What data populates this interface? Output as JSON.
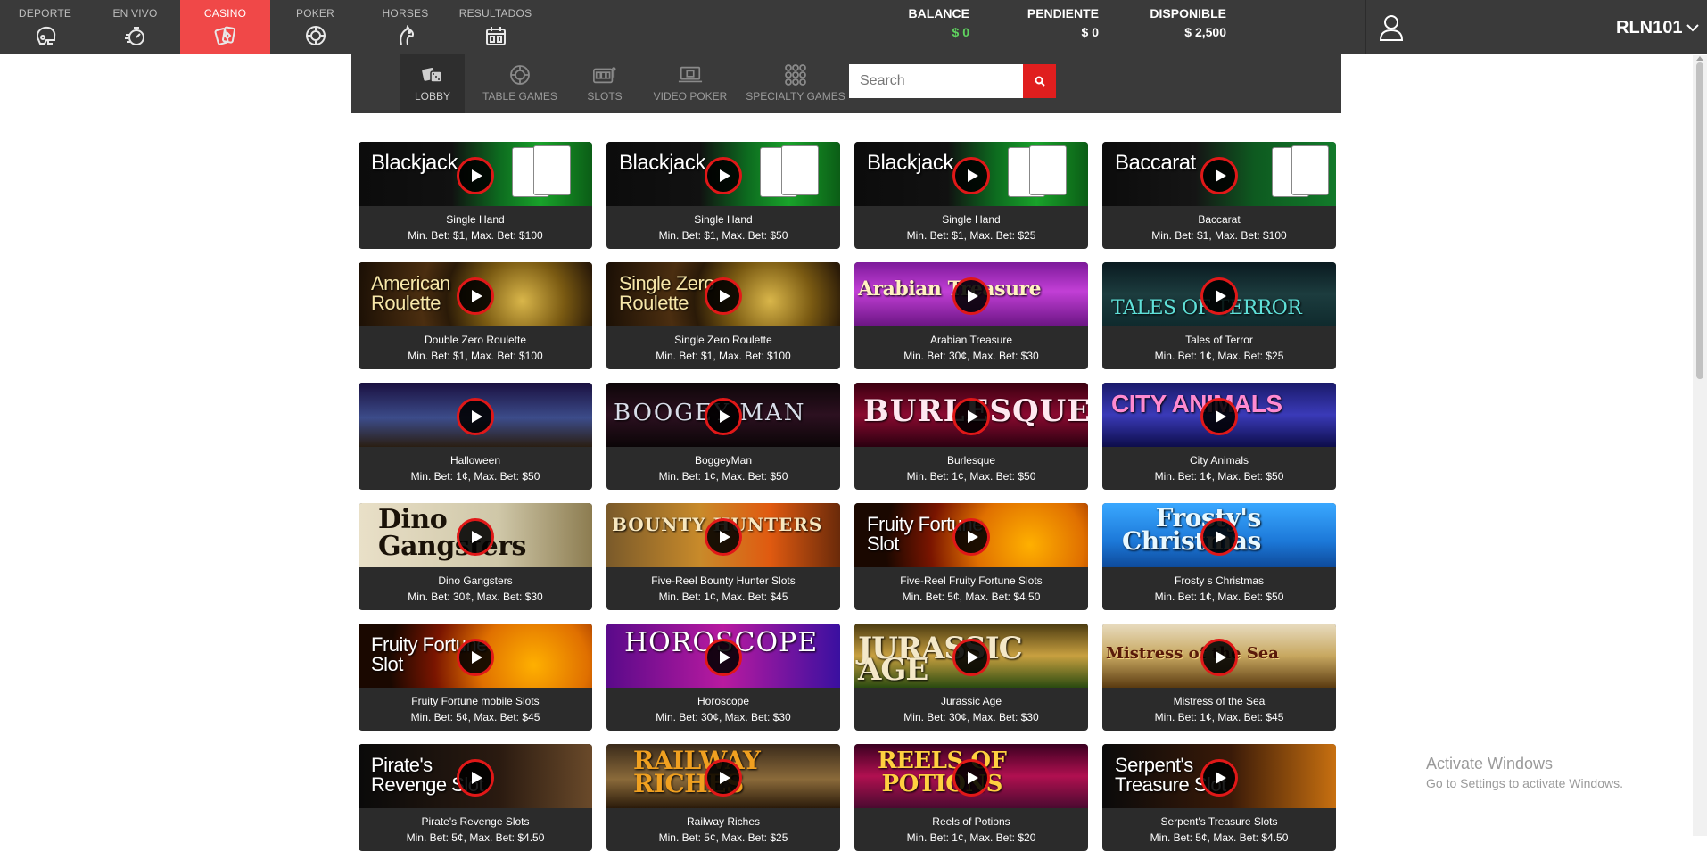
{
  "topnav": {
    "items": [
      {
        "label": "DEPORTE",
        "icon": "football-helmet-icon"
      },
      {
        "label": "EN VIVO",
        "icon": "stopwatch-icon"
      },
      {
        "label": "CASINO",
        "icon": "cards-icon",
        "active": true
      },
      {
        "label": "POKER",
        "icon": "poker-chip-icon"
      },
      {
        "label": "HORSES",
        "icon": "horse-icon"
      },
      {
        "label": "RESULTADOS",
        "icon": "calendar-icon"
      }
    ],
    "active_color": "#f04848"
  },
  "balances": {
    "balance_label": "BALANCE",
    "balance_value": "$ 0",
    "pendiente_label": "PENDIENTE",
    "pendiente_value": "$ 0",
    "disponible_label": "DISPONIBLE",
    "disponible_value": "$ 2,500",
    "balance_color": "#5fd35f"
  },
  "user": {
    "name": "RLN101",
    "icon": "user-icon",
    "dropdown_icon": "chevron-down-icon"
  },
  "subnav": {
    "categories": [
      {
        "label": "LOBBY",
        "icon": "dice-icon",
        "active": true
      },
      {
        "label": "TABLE GAMES",
        "icon": "roulette-icon"
      },
      {
        "label": "SLOTS",
        "icon": "slot-machine-icon"
      },
      {
        "label": "VIDEO POKER",
        "icon": "laptop-cards-icon"
      },
      {
        "label": "SPECIALTY GAMES",
        "icon": "grid-dots-icon"
      }
    ],
    "search_placeholder": "Search",
    "search_button_icon": "search-icon",
    "search_button_color": "#e01e1e"
  },
  "games": [
    {
      "banner": "Blackjack",
      "name": "Single Hand",
      "bets": "Min. Bet: $1, Max. Bet: $100"
    },
    {
      "banner": "Blackjack",
      "name": "Single Hand",
      "bets": "Min. Bet: $1, Max. Bet: $50"
    },
    {
      "banner": "Blackjack",
      "name": "Single Hand",
      "bets": "Min. Bet: $1, Max. Bet: $25"
    },
    {
      "banner": "Baccarat",
      "name": "Baccarat",
      "bets": "Min. Bet: $1, Max. Bet: $100"
    },
    {
      "banner": "American\nRoulette",
      "name": "Double Zero Roulette",
      "bets": "Min. Bet: $1, Max. Bet: $100"
    },
    {
      "banner": "Single Zero\nRoulette",
      "name": "Single Zero Roulette",
      "bets": "Min. Bet: $1, Max. Bet: $100"
    },
    {
      "banner": "Arabian Treasure",
      "name": "Arabian Treasure",
      "bets": "Min. Bet: 30¢, Max. Bet: $30"
    },
    {
      "banner": "TALES OF TERROR",
      "name": "Tales of Terror",
      "bets": "Min. Bet: 1¢, Max. Bet: $25"
    },
    {
      "banner": "",
      "name": "Halloween",
      "bets": "Min. Bet: 1¢, Max. Bet: $50"
    },
    {
      "banner": "BOOGEY MAN",
      "name": "BoggeyMan",
      "bets": "Min. Bet: 1¢, Max. Bet: $50"
    },
    {
      "banner": "BURLESQUE",
      "name": "Burlesque",
      "bets": "Min. Bet: 1¢, Max. Bet: $50"
    },
    {
      "banner": "CITY ANIMALS",
      "name": "City Animals",
      "bets": "Min. Bet: 1¢, Max. Bet: $50"
    },
    {
      "banner": "Dino\nGangsters",
      "name": "Dino Gangsters",
      "bets": "Min. Bet: 30¢, Max. Bet: $30"
    },
    {
      "banner": "BOUNTY HUNTERS",
      "name": "Five-Reel Bounty Hunter Slots",
      "bets": "Min. Bet: 1¢, Max. Bet: $45"
    },
    {
      "banner": "Fruity Fortune\nSlot",
      "name": "Five-Reel Fruity Fortune Slots",
      "bets": "Min. Bet: 5¢, Max. Bet: $4.50"
    },
    {
      "banner": "Frosty's\nChristmas",
      "name": "Frosty s Christmas",
      "bets": "Min. Bet: 1¢, Max. Bet: $50"
    },
    {
      "banner": "Fruity Fortune\nSlot",
      "name": "Fruity Fortune mobile Slots",
      "bets": "Min. Bet: 5¢, Max. Bet: $45"
    },
    {
      "banner": "HOROSCOPE",
      "name": "Horoscope",
      "bets": "Min. Bet: 30¢, Max. Bet: $30"
    },
    {
      "banner": "JURASSIC AGE",
      "name": "Jurassic Age",
      "bets": "Min. Bet: 30¢, Max. Bet: $30"
    },
    {
      "banner": "Mistress of the Sea",
      "name": "Mistress of the Sea",
      "bets": "Min. Bet: 1¢, Max. Bet: $45"
    },
    {
      "banner": "Pirate's\nRevenge Slot",
      "name": "Pirate's Revenge Slots",
      "bets": "Min. Bet: 5¢, Max. Bet: $4.50"
    },
    {
      "banner": "RAILWAY\nRICHES",
      "name": "Railway Riches",
      "bets": "Min. Bet: 5¢, Max. Bet: $25"
    },
    {
      "banner": "REELS OF\nPOTIONS",
      "name": "Reels of Potions",
      "bets": "Min. Bet: 1¢, Max. Bet: $20"
    },
    {
      "banner": "Serpent's\nTreasure Slot",
      "name": "Serpent's Treasure Slots",
      "bets": "Min. Bet: 5¢, Max. Bet: $4.50"
    }
  ],
  "watermark": {
    "line1": "Activate Windows",
    "line2": "Go to Settings to activate Windows."
  }
}
